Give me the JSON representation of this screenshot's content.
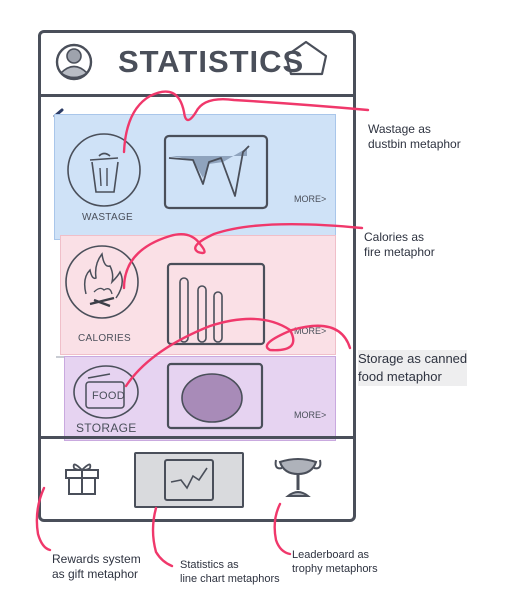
{
  "header": {
    "title": "STATISTICS"
  },
  "tiles": [
    {
      "id": "wastage",
      "label": "WASTAGE",
      "more": "MORE>"
    },
    {
      "id": "calories",
      "label": "CALORIES",
      "more": "MORE>"
    },
    {
      "id": "storage",
      "label": "STORAGE",
      "badge": "FOOD",
      "more": "MORE>"
    }
  ],
  "annotations": {
    "wastage": [
      "Wastage as",
      "dustbin metaphor"
    ],
    "calories": [
      "Calories as",
      "fire metaphor"
    ],
    "storage": [
      "Storage as canned",
      "food metaphor"
    ],
    "rewards": [
      "Rewards system",
      "as gift metaphor"
    ],
    "statistics": [
      "Statistics as",
      "line chart metaphors"
    ],
    "leaderboard": [
      "Leaderboard as",
      "trophy metaphors"
    ]
  },
  "colors": {
    "wastage_tile": "#cfe2f7",
    "calories_tile": "#fae0e6",
    "storage_tile": "#e6d3f1",
    "nav_selected": "#d9dadd",
    "annotation_pointer": "#f0386b",
    "sketch_ink": "#4a4f5a"
  }
}
